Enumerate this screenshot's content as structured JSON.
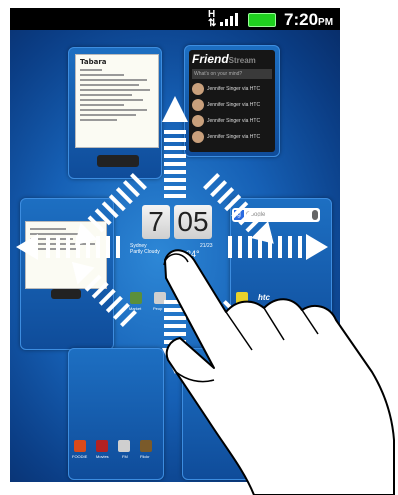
{
  "status_bar": {
    "network": "H",
    "time": "7:20",
    "ampm": "PM"
  },
  "clock_widget": {
    "hour": "7",
    "minute": "05",
    "location": "Sydney",
    "condition": "Partly Cloudy",
    "temperature": "24°",
    "low_high": "21/23"
  },
  "notes_panel": {
    "title": "Tabara"
  },
  "friendstream_panel": {
    "title": "Friend",
    "title_suffix": "Stream",
    "search_placeholder": "What's on your mind?",
    "posts": [
      {
        "name": "Jennifer Singer",
        "via": "via HTC"
      },
      {
        "name": "Jennifer Singer",
        "via": "via HTC"
      },
      {
        "name": "Jennifer Singer",
        "via": "via HTC"
      },
      {
        "name": "Jennifer Singer",
        "via": "via HTC"
      }
    ]
  },
  "search_widget": {
    "placeholder": "Google"
  },
  "center_apps": [
    {
      "label": "Market"
    },
    {
      "label": "Peop"
    }
  ],
  "dock_apps": [
    {
      "label": "FOODIE"
    },
    {
      "label": "Movies"
    },
    {
      "label": "FM"
    },
    {
      "label": "Flickr"
    }
  ],
  "right_apps": [
    {
      "label": "htc"
    }
  ],
  "colors": {
    "wallpaper": "#1660b5",
    "battery": "#1fd11f",
    "arrow": "#ffffff"
  }
}
